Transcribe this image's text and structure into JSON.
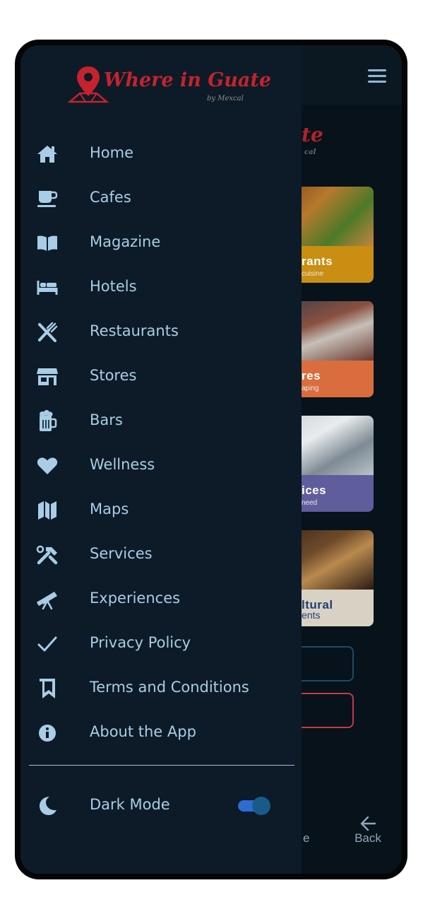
{
  "app": {
    "logo_text": "Where in Guate",
    "logo_sub": "by Mexcal"
  },
  "menu": {
    "items": [
      {
        "label": "Home",
        "icon": "home-icon"
      },
      {
        "label": "Cafes",
        "icon": "coffee-cup-icon"
      },
      {
        "label": "Magazine",
        "icon": "open-book-icon"
      },
      {
        "label": "Hotels",
        "icon": "bed-icon"
      },
      {
        "label": "Restaurants",
        "icon": "utensils-icon"
      },
      {
        "label": "Stores",
        "icon": "store-icon"
      },
      {
        "label": "Bars",
        "icon": "beer-mug-icon"
      },
      {
        "label": "Wellness",
        "icon": "heart-icon"
      },
      {
        "label": "Maps",
        "icon": "map-icon"
      },
      {
        "label": "Services",
        "icon": "tools-icon"
      },
      {
        "label": "Experiences",
        "icon": "telescope-icon"
      },
      {
        "label": "Privacy Policy",
        "icon": "checkmark-icon"
      },
      {
        "label": "Terms and Conditions",
        "icon": "bookmarks-icon"
      },
      {
        "label": "About the App",
        "icon": "info-icon"
      }
    ]
  },
  "dark_mode": {
    "label": "Dark Mode",
    "enabled": true,
    "icon": "moon-icon"
  },
  "background": {
    "logo_fragment": "te",
    "logo_fragment_sub": "cal",
    "cards": [
      {
        "title": "rants",
        "subtitle": "cuisine",
        "color": "#c98e12"
      },
      {
        "title": "res",
        "subtitle": "aping",
        "color": "#d96d3d"
      },
      {
        "title": "ices",
        "subtitle": "need",
        "color": "#5f5d9c"
      },
      {
        "title": "ltural",
        "subtitle": "ents",
        "color": "#d9d2c4"
      }
    ],
    "bottom_nav": {
      "fragment_label": "e",
      "back_label": "Back"
    }
  },
  "colors": {
    "drawer_bg": "#0c1b27",
    "menu_text": "#a9cde6",
    "brand_red": "#c4232d",
    "toggle_on": "#2e6bd3"
  }
}
